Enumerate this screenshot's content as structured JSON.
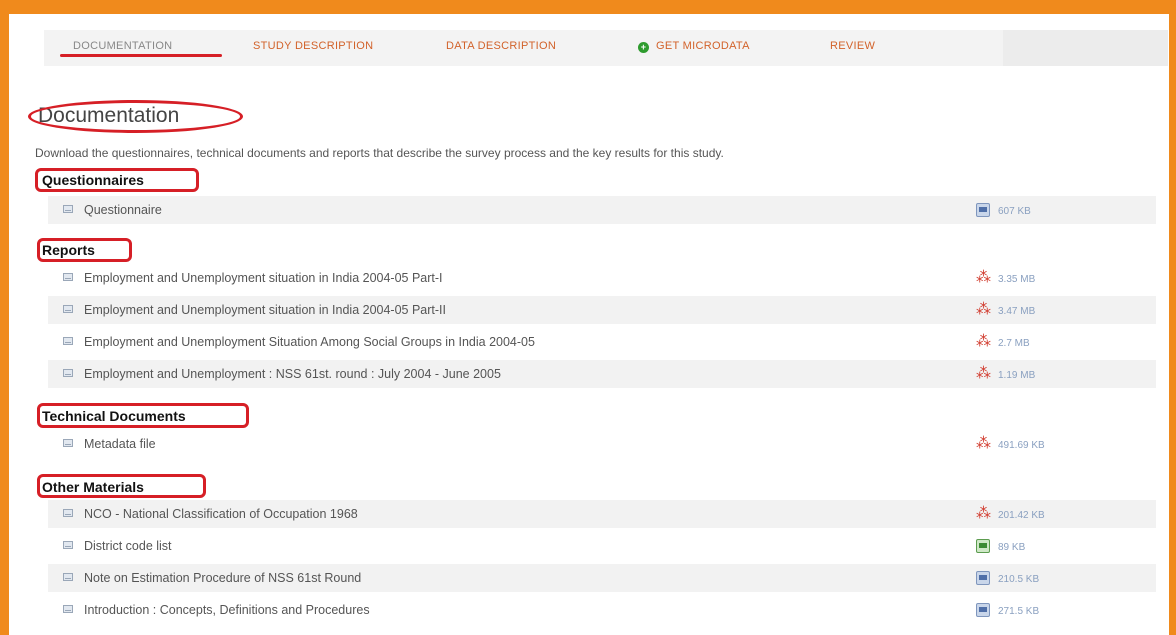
{
  "tabs": [
    {
      "label": "DOCUMENTATION",
      "active": true
    },
    {
      "label": "STUDY DESCRIPTION",
      "active": false
    },
    {
      "label": "DATA DESCRIPTION",
      "active": false
    },
    {
      "label": "GET MICRODATA",
      "active": false,
      "icon": "plus-circle-icon"
    },
    {
      "label": "REVIEW",
      "active": false
    }
  ],
  "page": {
    "title": "Documentation",
    "description": "Download the questionnaires, technical documents and reports that describe the survey process and the key results for this study."
  },
  "colors": {
    "frame": "#f08a1c",
    "highlight": "#d61f26",
    "tab_text": "#d2622a",
    "size_text": "#8aa0c0"
  },
  "sections": [
    {
      "title": "Questionnaires",
      "items": [
        {
          "title": "Questionnaire",
          "file_icon": "word-doc-icon",
          "size": "607 KB"
        }
      ]
    },
    {
      "title": "Reports",
      "items": [
        {
          "title": "Employment and Unemployment situation in India 2004-05 Part-I",
          "file_icon": "pdf-icon",
          "size": "3.35 MB"
        },
        {
          "title": "Employment and Unemployment situation in India 2004-05 Part-II",
          "file_icon": "pdf-icon",
          "size": "3.47 MB"
        },
        {
          "title": "Employment and Unemployment Situation Among Social Groups in India 2004-05",
          "file_icon": "pdf-icon",
          "size": "2.7 MB"
        },
        {
          "title": "Employment and Unemployment : NSS 61st. round : July 2004 - June 2005",
          "file_icon": "pdf-icon",
          "size": "1.19 MB"
        }
      ]
    },
    {
      "title": "Technical Documents",
      "items": [
        {
          "title": "Metadata file",
          "file_icon": "pdf-icon",
          "size": "491.69 KB"
        }
      ]
    },
    {
      "title": "Other Materials",
      "items": [
        {
          "title": "NCO - National Classification of Occupation 1968",
          "file_icon": "pdf-icon",
          "size": "201.42 KB"
        },
        {
          "title": "District code list",
          "file_icon": "excel-icon",
          "size": "89 KB"
        },
        {
          "title": "Note on Estimation Procedure of NSS 61st Round",
          "file_icon": "word-doc-icon",
          "size": "210.5 KB"
        },
        {
          "title": "Introduction : Concepts, Definitions and Procedures",
          "file_icon": "word-doc-icon",
          "size": "271.5 KB"
        }
      ]
    }
  ]
}
